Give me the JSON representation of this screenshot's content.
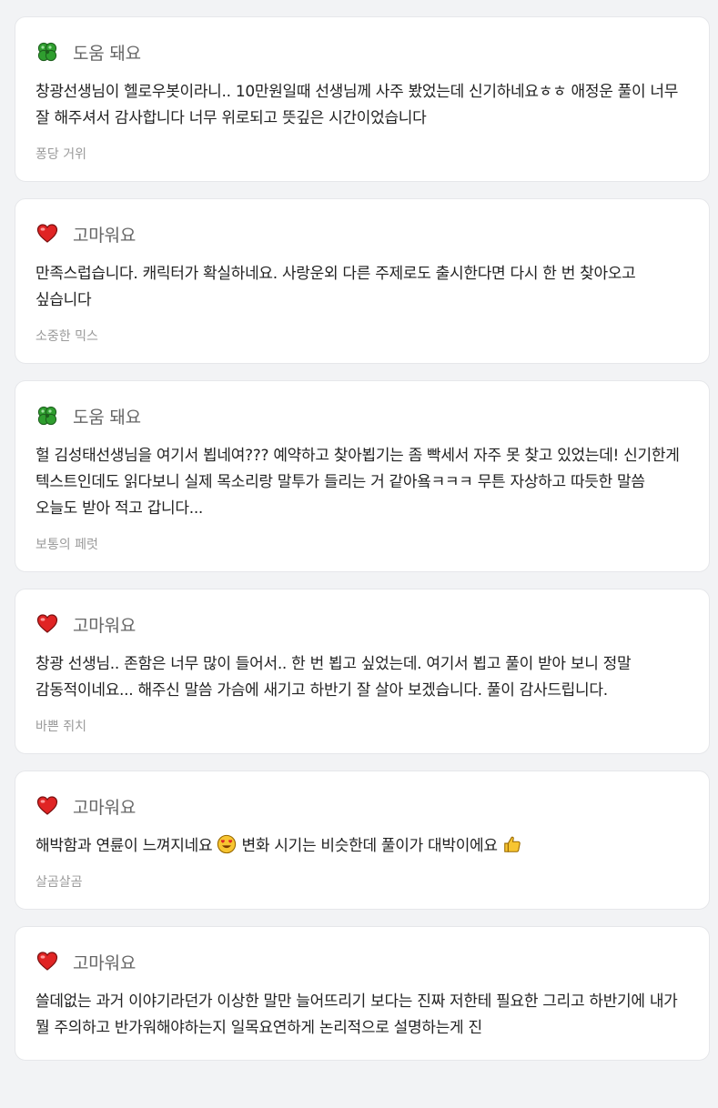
{
  "reviews": [
    {
      "badge": "도움 돼요",
      "icon": "clover-icon",
      "text": "창광선생님이 헬로우봇이라니.. 10만원일때 선생님께 사주 봤었는데 신기하네요ㅎㅎ 애정운 풀이 너무 잘 해주셔서 감사합니다 너무 위로되고 뜻깊은 시간이었습니다",
      "author": "퐁당 거위"
    },
    {
      "badge": "고마워요",
      "icon": "heart-icon",
      "text": "만족스럽습니다. 캐릭터가 확실하네요. 사랑운외 다른 주제로도 출시한다면 다시 한 번 찾아오고 싶습니다",
      "author": "소중한 믹스"
    },
    {
      "badge": "도움 돼요",
      "icon": "clover-icon",
      "text": "헐 김성태선생님을 여기서 뵙네여??? 예약하고 찾아뵙기는 좀 빡세서 자주 못 찾고 있었는데! 신기한게 텍스트인데도 읽다보니 실제 목소리랑 말투가 들리는 거 같아욬ㅋㅋㅋ 무튼 자상하고 따듯한 말씀 오늘도 받아 적고 갑니다...",
      "author": "보통의 페럿"
    },
    {
      "badge": "고마워요",
      "icon": "heart-icon",
      "text": "창광 선생님.. 존함은 너무 많이 들어서.. 한 번 뵙고 싶었는데. 여기서 뵙고 풀이 받아 보니 정말 감동적이네요... 해주신 말씀 가슴에 새기고 하반기 잘 살아 보겠습니다. 풀이 감사드립니다.",
      "author": "바쁜 쥐치"
    },
    {
      "badge": "고마워요",
      "icon": "heart-icon",
      "text_a": "해박함과 연륜이 느껴지네요",
      "text_b": " 변화 시기는 비슷한데 풀이가 대박이에요",
      "author": "살곰살곰"
    },
    {
      "badge": "고마워요",
      "icon": "heart-icon",
      "text": "쓸데없는 과거 이야기라던가 이상한 말만 늘어뜨리기 보다는 진짜 저한테 필요한 그리고 하반기에 내가 뭘 주의하고 반가워해야하는지 일목요연하게 논리적으로 설명하는게 진"
    }
  ]
}
